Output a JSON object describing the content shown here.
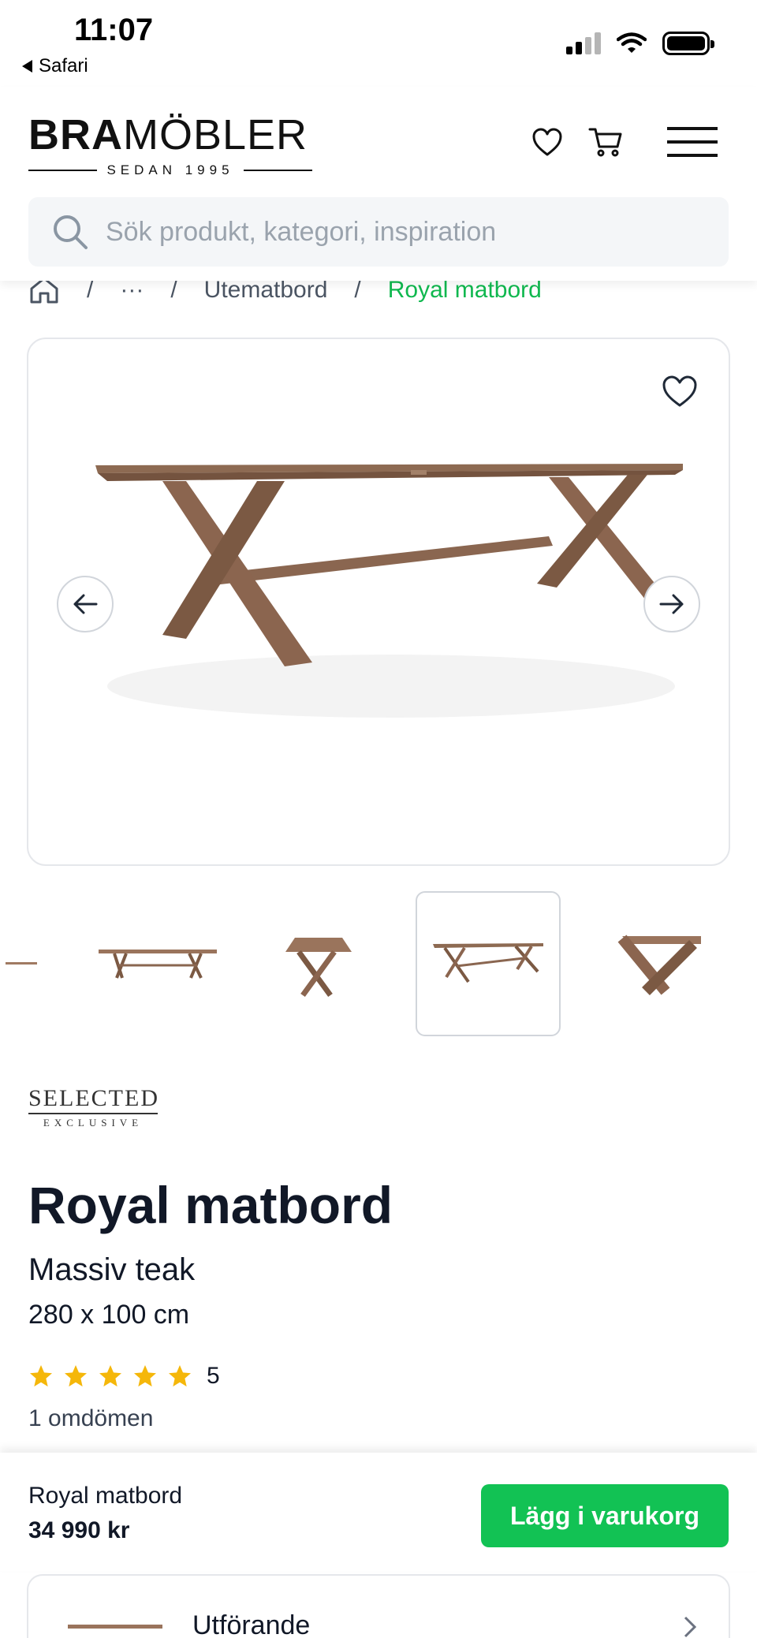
{
  "status_bar": {
    "time": "11:07",
    "back_app": "Safari"
  },
  "header": {
    "logo_bold": "BRA",
    "logo_regular": "MÖBLER",
    "logo_sub": "SEDAN 1995",
    "icons": [
      "heart-icon",
      "cart-icon",
      "menu-icon"
    ]
  },
  "search": {
    "placeholder": "Sök produkt, kategori, inspiration"
  },
  "breadcrumb": {
    "more": "···",
    "category": "Utematbord",
    "current": "Royal matbord"
  },
  "gallery": {
    "thumbnail_count": 5,
    "active_thumbnail": 4
  },
  "product": {
    "brand_line1": "SELECTED",
    "brand_line2": "EXCLUSIVE",
    "title": "Royal matbord",
    "material": "Massiv teak",
    "size": "280 x 100 cm",
    "rating": "5",
    "stars": 5,
    "reviews": "1 omdömen"
  },
  "sticky_bar": {
    "name": "Royal matbord",
    "price": "34 990 kr",
    "button": "Lägg i varukorg"
  },
  "variant": {
    "label": "Utförande"
  },
  "colors": {
    "accent_green": "#12c254",
    "breadcrumb_green": "#10b84f",
    "star_yellow": "#f5b70a",
    "text_dark": "#111827"
  }
}
